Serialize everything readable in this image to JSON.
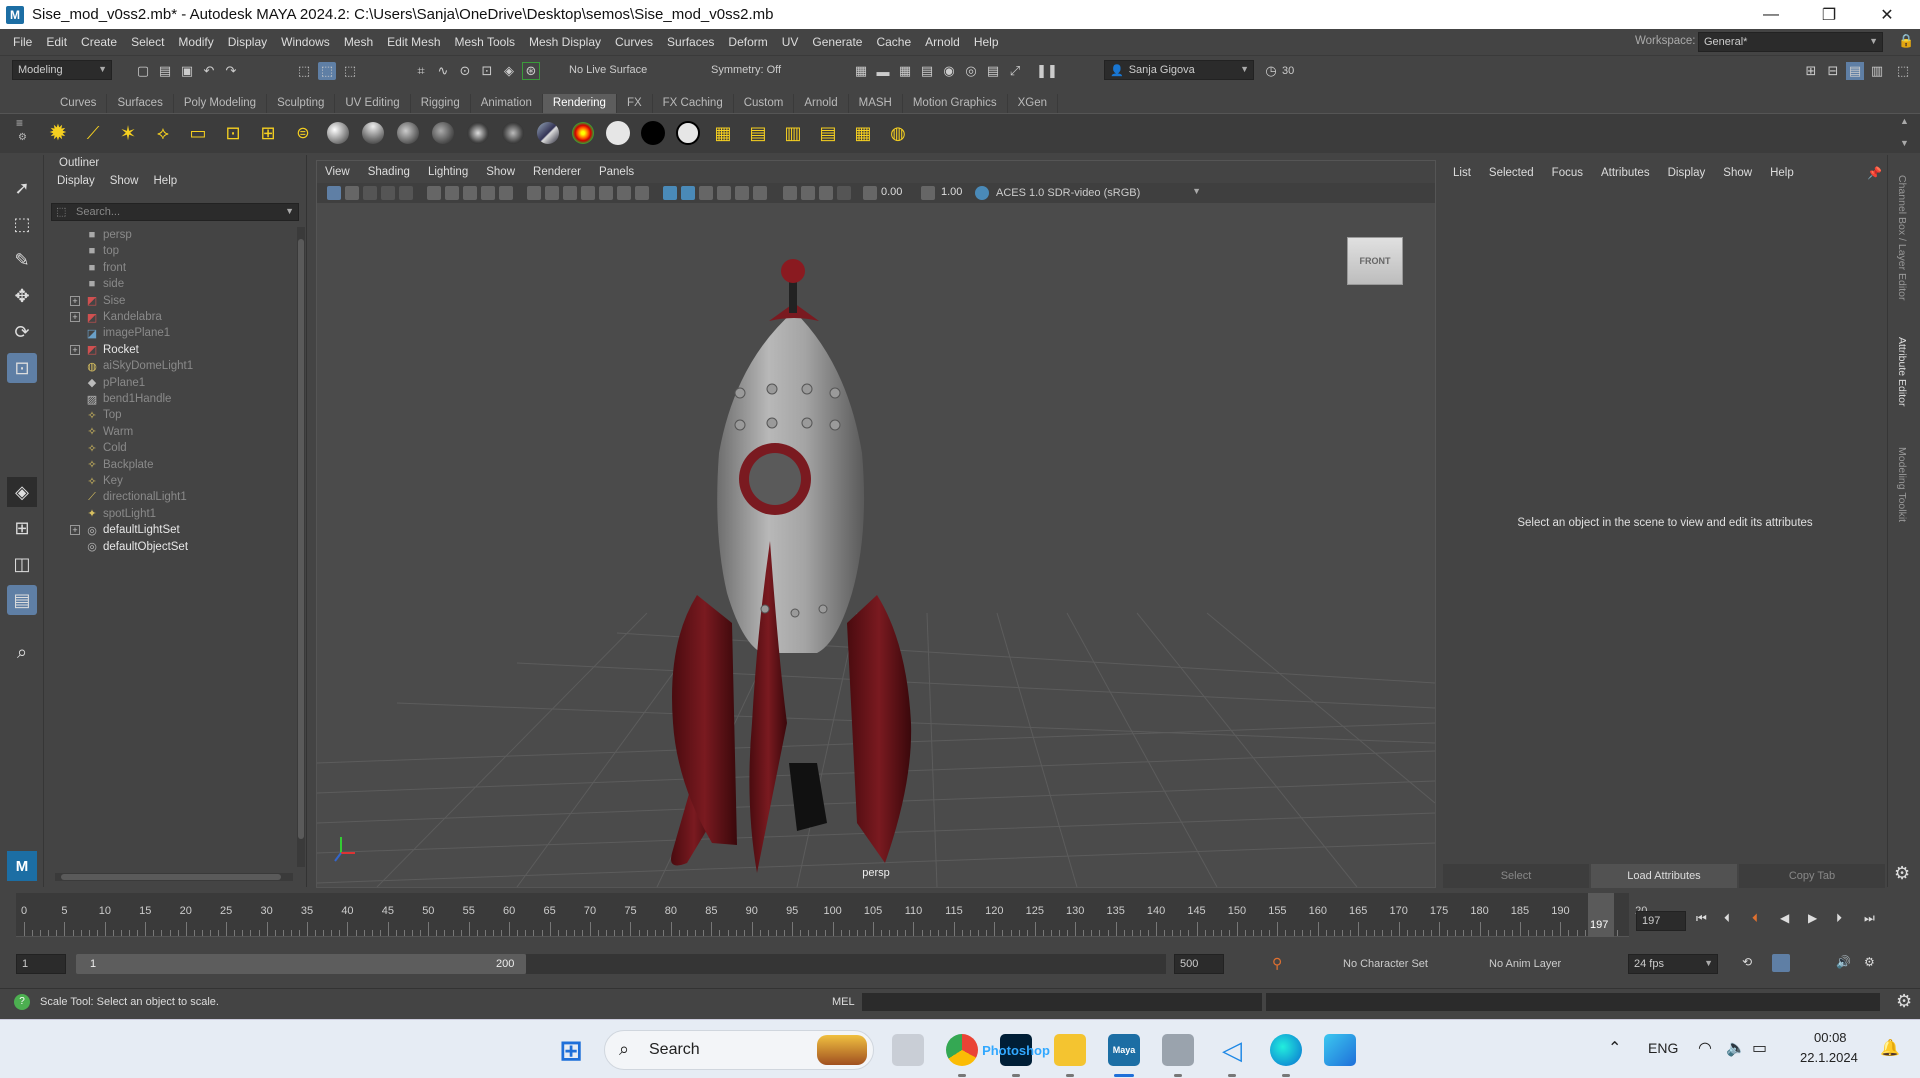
{
  "window": {
    "title": "Sise_mod_v0ss2.mb* - Autodesk MAYA 2024.2: C:\\Users\\Sanja\\OneDrive\\Desktop\\semos\\Sise_mod_v0ss2.mb",
    "minimize": "—",
    "maximize": "❐",
    "close": "✕"
  },
  "menubar": {
    "items": [
      "File",
      "Edit",
      "Create",
      "Select",
      "Modify",
      "Display",
      "Windows",
      "Mesh",
      "Edit Mesh",
      "Mesh Tools",
      "Mesh Display",
      "Curves",
      "Surfaces",
      "Deform",
      "UV",
      "Generate",
      "Cache",
      "Arnold",
      "Help"
    ],
    "workspace_label": "Workspace:",
    "workspace_value": "General*"
  },
  "statusline": {
    "menuset": "Modeling",
    "live_surface": "No Live Surface",
    "symmetry": "Symmetry: Off",
    "user": "Sanja Gigova",
    "credits": "30"
  },
  "shelf": {
    "tabs": [
      "Curves",
      "Surfaces",
      "Poly Modeling",
      "Sculpting",
      "UV Editing",
      "Rigging",
      "Animation",
      "Rendering",
      "FX",
      "FX Caching",
      "Custom",
      "Arnold",
      "MASH",
      "Motion Graphics",
      "XGen"
    ],
    "active_tab": "Rendering"
  },
  "outliner": {
    "title": "Outliner",
    "menu": [
      "Display",
      "Show",
      "Help"
    ],
    "search_placeholder": "Search...",
    "items": [
      {
        "label": "persp",
        "icon": "camera-icon",
        "expand": false,
        "dim": true
      },
      {
        "label": "top",
        "icon": "camera-icon",
        "expand": false,
        "dim": true
      },
      {
        "label": "front",
        "icon": "camera-icon",
        "expand": false,
        "dim": true
      },
      {
        "label": "side",
        "icon": "camera-icon",
        "expand": false,
        "dim": true
      },
      {
        "label": "Sise",
        "icon": "transform-icon",
        "expand": true,
        "dim": true
      },
      {
        "label": "Kandelabra",
        "icon": "transform-icon",
        "expand": true,
        "dim": true
      },
      {
        "label": "imagePlane1",
        "icon": "image-plane-icon",
        "expand": false,
        "dim": true
      },
      {
        "label": "Rocket",
        "icon": "transform-icon",
        "expand": true,
        "dim": false
      },
      {
        "label": "aiSkyDomeLight1",
        "icon": "skydome-light-icon",
        "expand": false,
        "dim": true
      },
      {
        "label": "pPlane1",
        "icon": "mesh-icon",
        "expand": false,
        "dim": true
      },
      {
        "label": "bend1Handle",
        "icon": "deformer-icon",
        "expand": false,
        "dim": true
      },
      {
        "label": "Top",
        "icon": "area-light-icon",
        "expand": false,
        "dim": true
      },
      {
        "label": "Warm",
        "icon": "area-light-icon",
        "expand": false,
        "dim": true
      },
      {
        "label": "Cold",
        "icon": "area-light-icon",
        "expand": false,
        "dim": true
      },
      {
        "label": "Backplate",
        "icon": "area-light-icon",
        "expand": false,
        "dim": true
      },
      {
        "label": "Key",
        "icon": "area-light-icon",
        "expand": false,
        "dim": true
      },
      {
        "label": "directionalLight1",
        "icon": "directional-light-icon",
        "expand": false,
        "dim": true
      },
      {
        "label": "spotLight1",
        "icon": "spot-light-icon",
        "expand": false,
        "dim": true
      },
      {
        "label": "defaultLightSet",
        "icon": "set-icon",
        "expand": true,
        "dim": false
      },
      {
        "label": "defaultObjectSet",
        "icon": "set-icon",
        "expand": false,
        "dim": false
      }
    ]
  },
  "viewport": {
    "menu": [
      "View",
      "Shading",
      "Lighting",
      "Show",
      "Renderer",
      "Panels"
    ],
    "exposure": "0.00",
    "gamma": "1.00",
    "colorspace": "ACES 1.0 SDR-video (sRGB)",
    "camera_label": "persp",
    "viewcube": "FRONT"
  },
  "attribute_editor": {
    "menu": [
      "List",
      "Selected",
      "Focus",
      "Attributes",
      "Display",
      "Show",
      "Help"
    ],
    "message": "Select an object in the scene to view and edit its attributes",
    "buttons": [
      "Select",
      "Load Attributes",
      "Copy Tab"
    ]
  },
  "side_tabs": [
    "Channel Box / Layer Editor",
    "Attribute Editor",
    "Modeling Toolkit"
  ],
  "timeline": {
    "ticks": [
      "0",
      "5",
      "10",
      "15",
      "20",
      "25",
      "30",
      "35",
      "40",
      "45",
      "50",
      "55",
      "60",
      "65",
      "70",
      "75",
      "80",
      "85",
      "90",
      "95",
      "100",
      "105",
      "110",
      "115",
      "120",
      "125",
      "130",
      "135",
      "140",
      "145",
      "150",
      "155",
      "160",
      "165",
      "170",
      "175",
      "180",
      "185",
      "190",
      "195",
      "20"
    ],
    "current_frame": "197",
    "current_frame_field": "197"
  },
  "range": {
    "start": "1",
    "inner_start": "1",
    "inner_end": "200",
    "end": "500",
    "character_set": "No Character Set",
    "anim_layer": "No Anim Layer",
    "fps": "24 fps"
  },
  "commandline": {
    "help_text": "Scale Tool: Select an object to scale.",
    "lang": "MEL"
  },
  "taskbar": {
    "search": "Search",
    "lang": "ENG",
    "time": "00:08",
    "date": "22.1.2024",
    "apps": [
      "Photoshop",
      "Maya"
    ]
  }
}
